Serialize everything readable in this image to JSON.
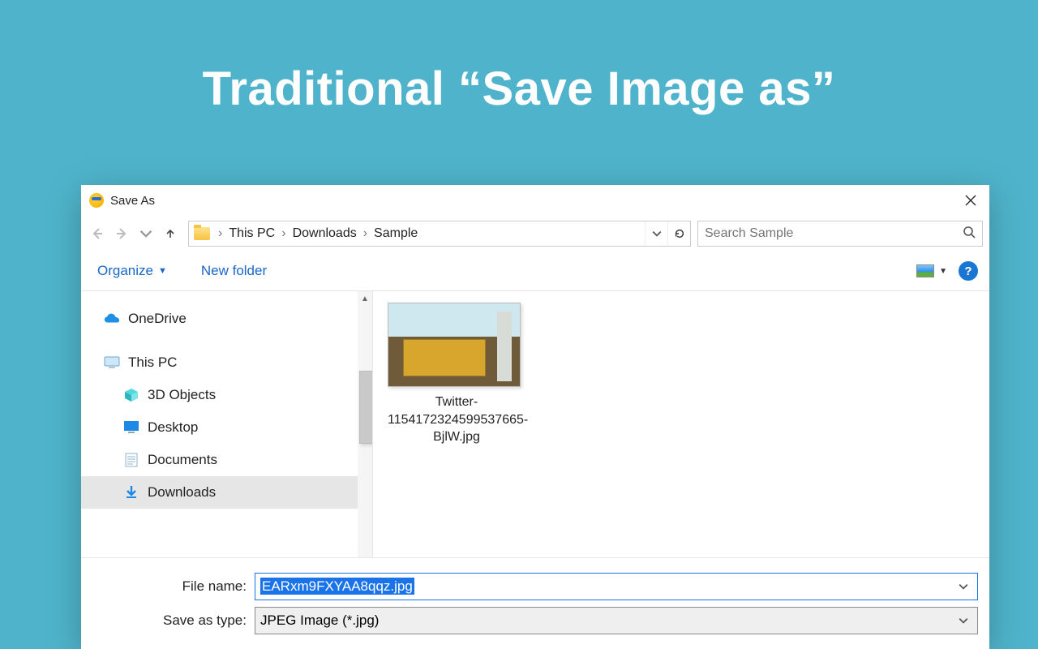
{
  "headline": "Traditional “Save Image as”",
  "dialog": {
    "title": "Save As",
    "breadcrumb": {
      "root": "This PC",
      "a": "Downloads",
      "b": "Sample"
    },
    "search_placeholder": "Search Sample",
    "toolbar": {
      "organize": "Organize",
      "new_folder": "New folder"
    },
    "tree": {
      "onedrive": "OneDrive",
      "thispc": "This PC",
      "objects3d": "3D Objects",
      "desktop": "Desktop",
      "documents": "Documents",
      "downloads": "Downloads"
    },
    "file_in_folder": "Twitter-1154172324599537665-BjlW.jpg",
    "form": {
      "filename_label": "File name:",
      "filename_value": "EARxm9FXYAA8qqz.jpg",
      "type_label": "Save as type:",
      "type_value": "JPEG Image (*.jpg)"
    }
  }
}
